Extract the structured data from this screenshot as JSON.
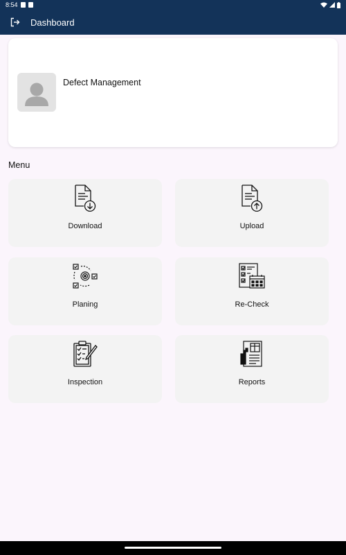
{
  "status_bar": {
    "time": "8:54"
  },
  "app_bar": {
    "title": "Dashboard"
  },
  "profile": {
    "name": "Defect Management"
  },
  "menu": {
    "title": "Menu",
    "items": [
      {
        "label": "Download",
        "icon": "file-download-icon"
      },
      {
        "label": "Upload",
        "icon": "file-upload-icon"
      },
      {
        "label": "Planing",
        "icon": "planning-cycle-icon"
      },
      {
        "label": "Re-Check",
        "icon": "checklist-calendar-icon"
      },
      {
        "label": "Inspection",
        "icon": "clipboard-inspection-icon"
      },
      {
        "label": "Reports",
        "icon": "report-document-icon"
      }
    ]
  },
  "colors": {
    "app_bar": "#133359",
    "background": "#fbf5fc",
    "card": "#f3f3f3"
  }
}
